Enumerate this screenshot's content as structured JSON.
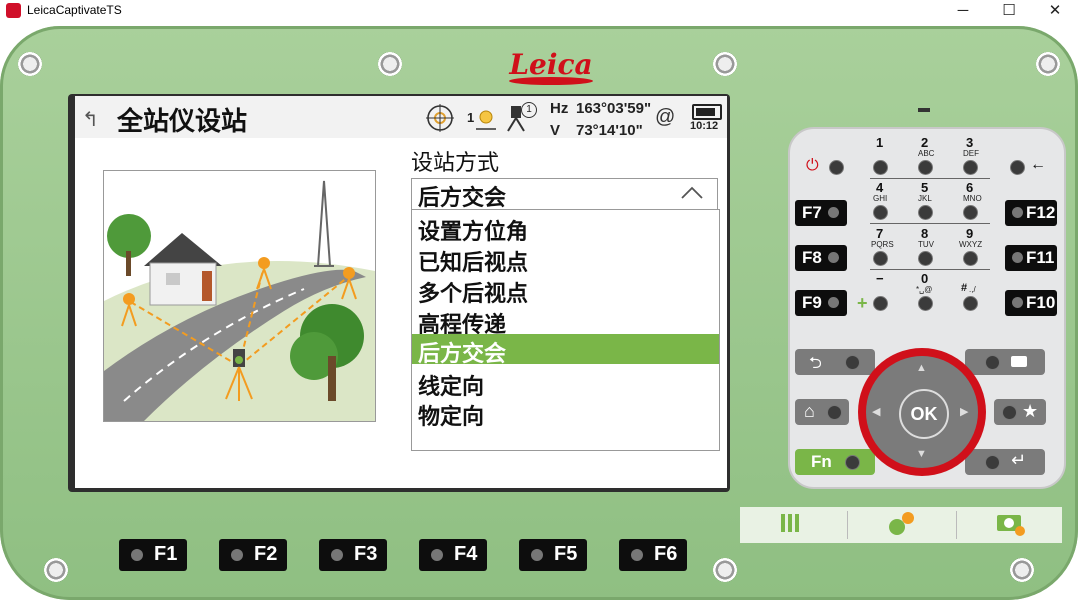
{
  "window": {
    "title": "LeicaCaptivateTS",
    "minimize_glyph": "─",
    "maximize_glyph": "☐",
    "close_glyph": "✕"
  },
  "brand": {
    "logo_text": "Leica",
    "logo_color": "#d0101a"
  },
  "screen": {
    "title": "全站仪设站",
    "back_glyph": "↰",
    "status": {
      "target_count": "1",
      "face_count": "1",
      "hz_label": "Hz",
      "hz_value": "163°03'59\"",
      "v_label": "V",
      "v_value": "73°14'10\"",
      "time": "10:12",
      "at_glyph": "@"
    },
    "section_label": "设站方式",
    "dropdown": {
      "value": "后方交会"
    },
    "options": [
      {
        "label": "设置方位角",
        "selected": false
      },
      {
        "label": "已知后视点",
        "selected": false
      },
      {
        "label": "多个后视点",
        "selected": false
      },
      {
        "label": "高程传递",
        "selected": false
      },
      {
        "label": "后方交会",
        "selected": true
      },
      {
        "label": "线定向",
        "selected": false
      },
      {
        "label": "物定向",
        "selected": false
      }
    ],
    "selection_color": "#7ab648"
  },
  "bottom_fkeys": [
    "F1",
    "F2",
    "F3",
    "F4",
    "F5",
    "F6"
  ],
  "keypad": {
    "keys": [
      {
        "num": "1",
        "sub": ""
      },
      {
        "num": "2",
        "sub": "ABC"
      },
      {
        "num": "3",
        "sub": "DEF"
      },
      {
        "num": "4",
        "sub": "GHI"
      },
      {
        "num": "5",
        "sub": "JKL"
      },
      {
        "num": "6",
        "sub": "MNO"
      },
      {
        "num": "7",
        "sub": "PQRS"
      },
      {
        "num": "8",
        "sub": "TUV"
      },
      {
        "num": "9",
        "sub": "WXYZ"
      },
      {
        "num": "−",
        "sub": ""
      },
      {
        "num": "0",
        "sub": "*␣@"
      },
      {
        "num": "#",
        "sub": ".,/"
      }
    ],
    "left_fkeys": [
      "F7",
      "F8",
      "F9"
    ],
    "right_fkeys": [
      "F12",
      "F11",
      "F10"
    ],
    "fn_label": "Fn",
    "ok_label": "OK",
    "back_glyph": "⮌",
    "home_glyph": "⌂",
    "star_glyph": "★",
    "enter_glyph": "↵"
  }
}
